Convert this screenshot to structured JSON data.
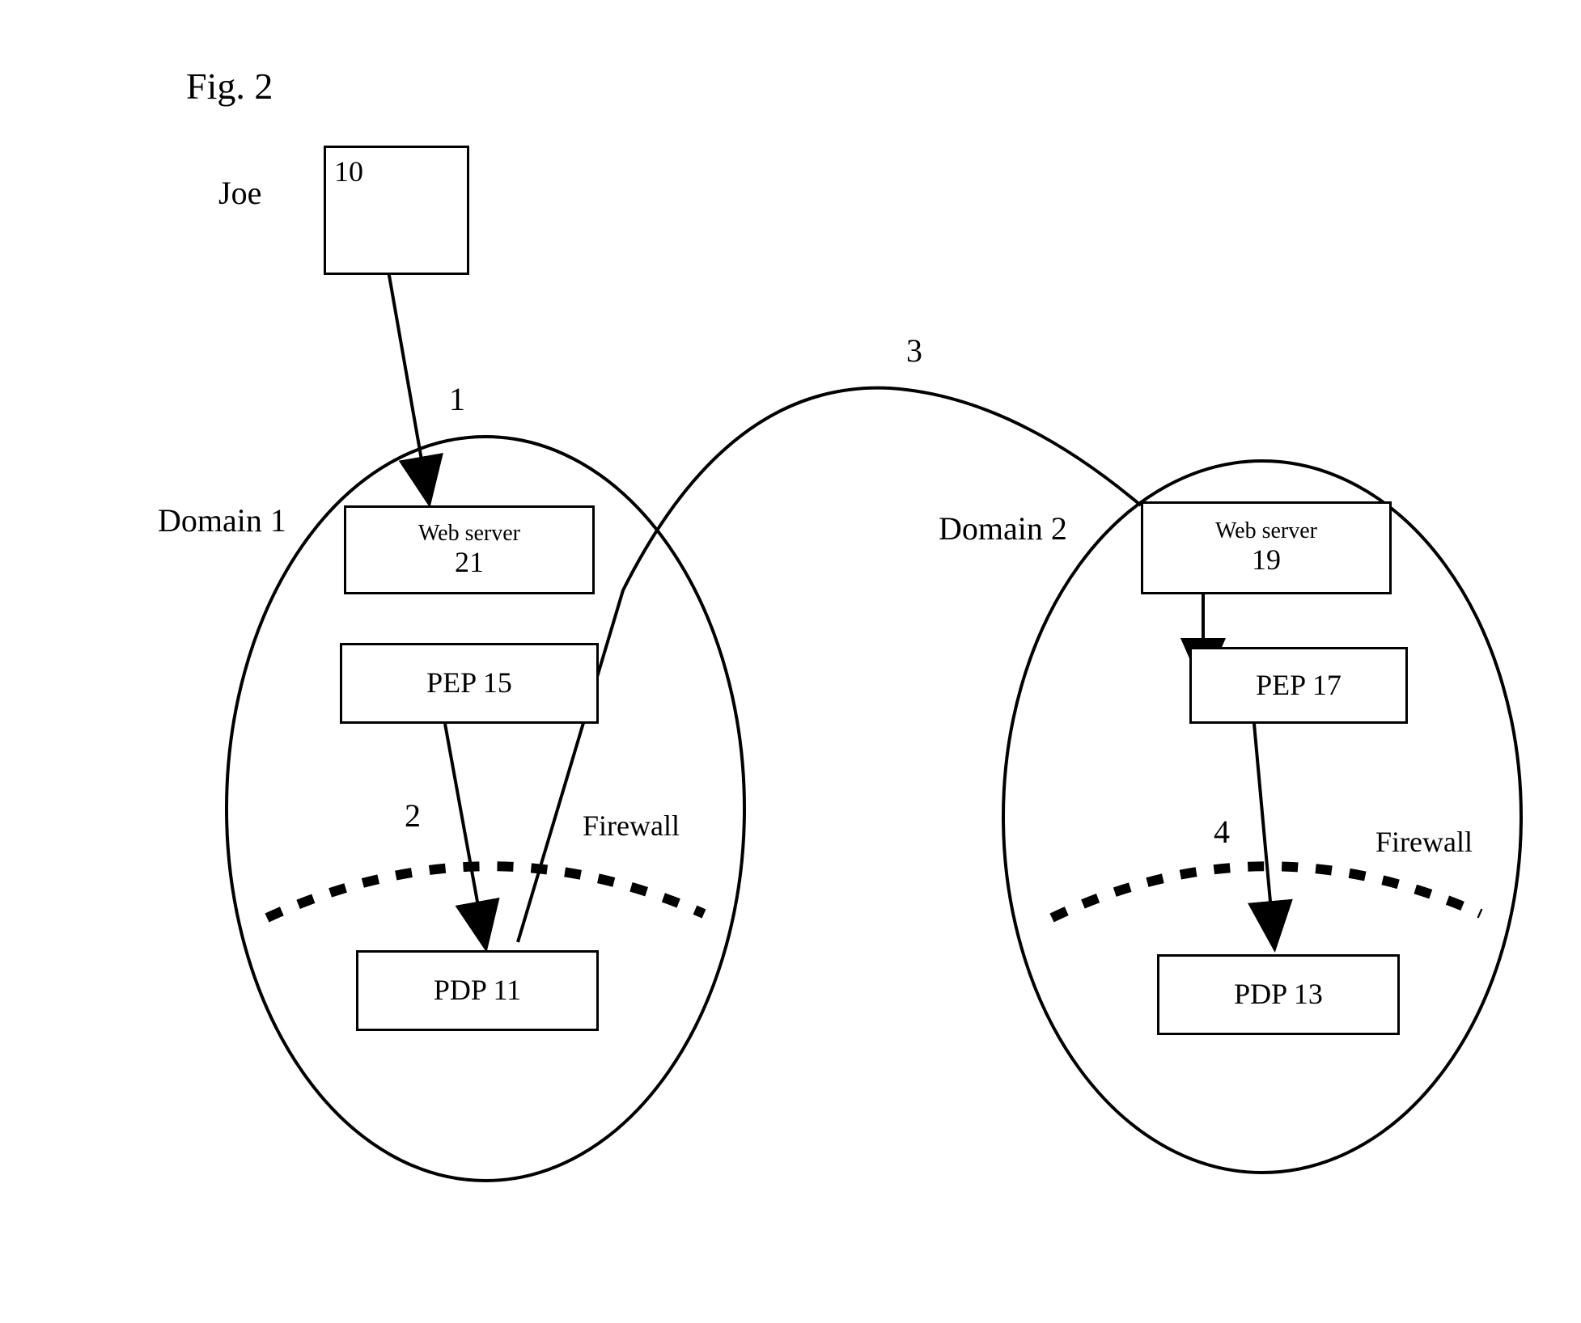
{
  "figure": {
    "caption": "Fig. 2"
  },
  "actor": {
    "name": "Joe",
    "box_id": "10"
  },
  "domain1": {
    "label": "Domain 1",
    "webserver": {
      "label": "Web server",
      "id": "21"
    },
    "pep": {
      "label": "PEP 15"
    },
    "pdp": {
      "label": "PDP 11"
    },
    "firewall": "Firewall"
  },
  "domain2": {
    "label": "Domain 2",
    "webserver": {
      "label": "Web server",
      "id": "19"
    },
    "pep": {
      "label": "PEP 17"
    },
    "pdp": {
      "label": "PDP 13"
    },
    "firewall": "Firewall"
  },
  "arrows": {
    "a1": "1",
    "a2": "2",
    "a3": "3",
    "a4": "4"
  }
}
